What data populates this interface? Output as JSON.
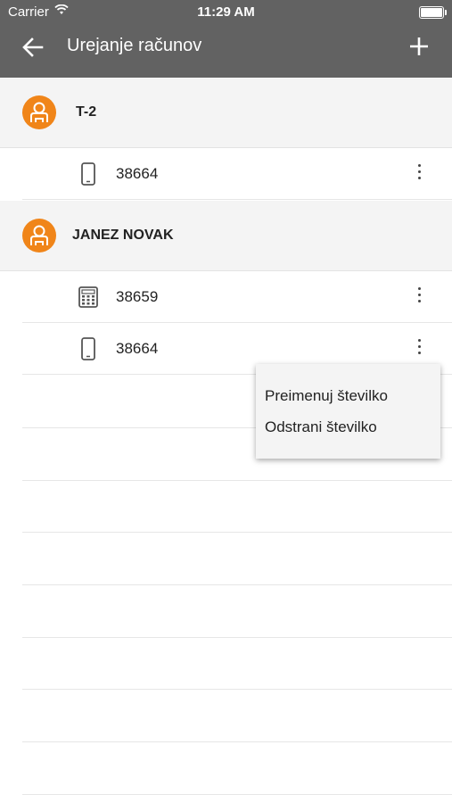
{
  "status_bar": {
    "carrier": "Carrier",
    "time": "11:29 AM"
  },
  "header": {
    "title": "Urejanje računov",
    "back_icon": "arrow-left-icon",
    "add_icon": "plus-icon"
  },
  "accounts": [
    {
      "name": "T-2",
      "numbers": [
        {
          "icon": "mobile-phone-icon",
          "number": "38664"
        }
      ]
    },
    {
      "name": "JANEZ NOVAK",
      "numbers": [
        {
          "icon": "landline-phone-icon",
          "number": "38659"
        },
        {
          "icon": "mobile-phone-icon",
          "number": "38664"
        }
      ]
    }
  ],
  "context_menu": {
    "items": [
      "Preimenuj številko",
      "Odstrani številko"
    ]
  },
  "colors": {
    "header_bg": "#626262",
    "accent": "#f08519",
    "group_bg": "#f4f4f4"
  }
}
